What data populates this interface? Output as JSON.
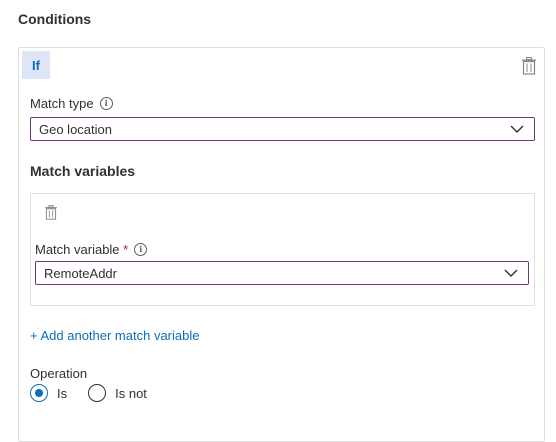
{
  "section_title": "Conditions",
  "condition": {
    "badge": "If",
    "match_type": {
      "label": "Match type",
      "info": "i",
      "value": "Geo location"
    },
    "match_variables": {
      "heading": "Match variables",
      "items": [
        {
          "label": "Match variable",
          "required_marker": "*",
          "info": "i",
          "value": "RemoteAddr"
        }
      ],
      "add_link": "+ Add another match variable"
    },
    "operation": {
      "label": "Operation",
      "options": [
        {
          "label": "Is",
          "selected": true
        },
        {
          "label": "Is not",
          "selected": false
        }
      ]
    }
  },
  "colors": {
    "accent": "#0f6cbd",
    "select_border": "#6b3a78",
    "required": "#a4262c",
    "badge_bg": "#dce6f7"
  },
  "icons": [
    "delete-icon",
    "info-icon",
    "chevron-down-icon",
    "radio-icon"
  ]
}
